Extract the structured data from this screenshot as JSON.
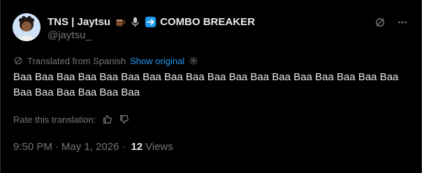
{
  "post": {
    "author": {
      "display_name": "TNS | Jaytsu",
      "emoji_1": "coffee-cup",
      "emoji_2": "microphone",
      "emoji_3": "right-arrow",
      "suffix": "COMBO BREAKER",
      "handle": "@jaytsu_"
    },
    "translation": {
      "label": "Translated from Spanish",
      "show_original": "Show original"
    },
    "text": "Baa Baa Baa Baa Baa Baa Baa Baa Baa Baa Baa Baa Baa Baa Baa Baa Baa Baa Baa Baa Baa Baa Baa Baa",
    "rate": {
      "label": "Rate this translation:"
    },
    "meta": {
      "time": "9:50 PM",
      "date": "May 1, 2026",
      "views_count": "12",
      "views_label": "Views",
      "sep": "·"
    },
    "icons": {
      "top_right_1": "grok-icon",
      "top_right_2": "more-icon",
      "translate": "translate-icon",
      "settings": "gear-icon",
      "thumbs_up": "thumbs-up-icon",
      "thumbs_down": "thumbs-down-icon"
    }
  }
}
